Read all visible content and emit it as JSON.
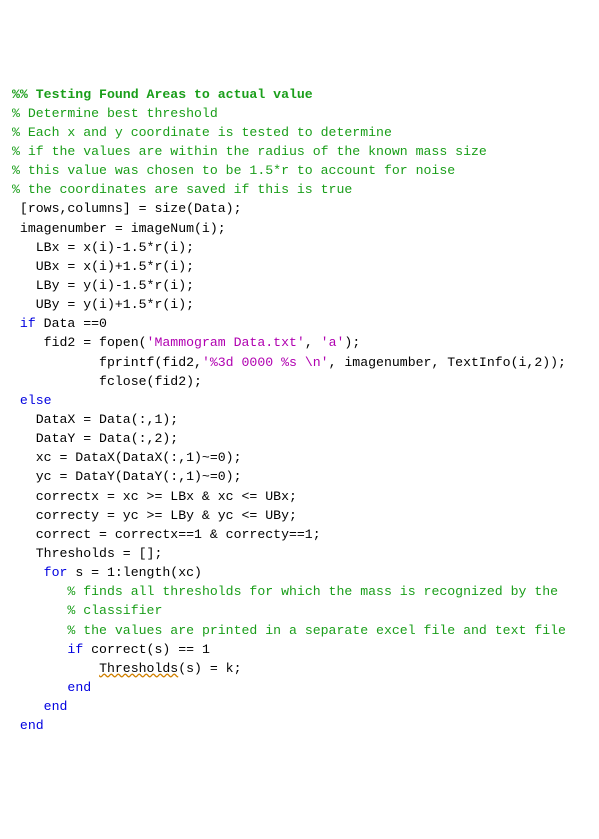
{
  "code": {
    "lines": [
      {
        "segments": [
          {
            "cls": "section",
            "text": "%% Testing Found Areas to actual value"
          }
        ]
      },
      {
        "segments": [
          {
            "cls": "comment",
            "text": "% Determine best threshold"
          }
        ]
      },
      {
        "segments": [
          {
            "cls": "comment",
            "text": "% Each x and y coordinate is tested to determine"
          }
        ]
      },
      {
        "segments": [
          {
            "cls": "comment",
            "text": "% if the values are within the radius of the known mass size"
          }
        ]
      },
      {
        "segments": [
          {
            "cls": "comment",
            "text": "% this value was chosen to be 1.5*r to account for noise"
          }
        ]
      },
      {
        "segments": [
          {
            "cls": "comment",
            "text": "% the coordinates are saved if this is true"
          }
        ]
      },
      {
        "segments": [
          {
            "cls": "code",
            "text": " [rows,columns] = size(Data);"
          }
        ]
      },
      {
        "segments": [
          {
            "cls": "code",
            "text": " imagenumber = imageNum(i);"
          }
        ]
      },
      {
        "segments": [
          {
            "cls": "code",
            "text": "   LBx = x(i)-1.5*r(i);"
          }
        ]
      },
      {
        "segments": [
          {
            "cls": "code",
            "text": "   UBx = x(i)+1.5*r(i);"
          }
        ]
      },
      {
        "segments": [
          {
            "cls": "code",
            "text": "   LBy = y(i)-1.5*r(i);"
          }
        ]
      },
      {
        "segments": [
          {
            "cls": "code",
            "text": "   UBy = y(i)+1.5*r(i);"
          }
        ]
      },
      {
        "segments": [
          {
            "cls": "code",
            "text": " "
          },
          {
            "cls": "keyword",
            "text": "if"
          },
          {
            "cls": "code",
            "text": " Data ==0"
          }
        ]
      },
      {
        "segments": [
          {
            "cls": "code",
            "text": "    fid2 = fopen("
          },
          {
            "cls": "string",
            "text": "'Mammogram Data.txt'"
          },
          {
            "cls": "code",
            "text": ", "
          },
          {
            "cls": "string",
            "text": "'a'"
          },
          {
            "cls": "code",
            "text": ");"
          }
        ]
      },
      {
        "segments": [
          {
            "cls": "code",
            "text": "           fprintf(fid2,"
          },
          {
            "cls": "string",
            "text": "'%3d 0000 %s \\n'"
          },
          {
            "cls": "code",
            "text": ", imagenumber, TextInfo(i,2));"
          }
        ]
      },
      {
        "segments": [
          {
            "cls": "code",
            "text": "           fclose(fid2);"
          }
        ]
      },
      {
        "segments": [
          {
            "cls": "code",
            "text": " "
          },
          {
            "cls": "keyword",
            "text": "else"
          }
        ]
      },
      {
        "segments": [
          {
            "cls": "code",
            "text": "   DataX = Data(:,1);"
          }
        ]
      },
      {
        "segments": [
          {
            "cls": "code",
            "text": "   DataY = Data(:,2);"
          }
        ]
      },
      {
        "segments": [
          {
            "cls": "code",
            "text": "   xc = DataX(DataX(:,1)~=0);"
          }
        ]
      },
      {
        "segments": [
          {
            "cls": "code",
            "text": "   yc = DataY(DataY(:,1)~=0);"
          }
        ]
      },
      {
        "segments": [
          {
            "cls": "code",
            "text": "   correctx = xc >= LBx & xc <= UBx;"
          }
        ]
      },
      {
        "segments": [
          {
            "cls": "code",
            "text": "   correcty = yc >= LBy & yc <= UBy;"
          }
        ]
      },
      {
        "segments": [
          {
            "cls": "code",
            "text": "   correct = correctx==1 & correcty==1;"
          }
        ]
      },
      {
        "segments": [
          {
            "cls": "code",
            "text": "   Thresholds = [];"
          }
        ]
      },
      {
        "segments": [
          {
            "cls": "code",
            "text": "    "
          },
          {
            "cls": "keyword",
            "text": "for"
          },
          {
            "cls": "code",
            "text": " s = 1:length(xc)"
          }
        ]
      },
      {
        "segments": [
          {
            "cls": "code",
            "text": "       "
          },
          {
            "cls": "comment",
            "text": "% finds all thresholds for which the mass is recognized by the"
          }
        ]
      },
      {
        "segments": [
          {
            "cls": "code",
            "text": "       "
          },
          {
            "cls": "comment",
            "text": "% classifier"
          }
        ]
      },
      {
        "segments": [
          {
            "cls": "code",
            "text": "       "
          },
          {
            "cls": "comment",
            "text": "% the values are printed in a separate excel file and text file"
          }
        ]
      },
      {
        "segments": [
          {
            "cls": "code",
            "text": "       "
          },
          {
            "cls": "keyword",
            "text": "if"
          },
          {
            "cls": "code",
            "text": " correct(s) == 1"
          }
        ]
      },
      {
        "segments": [
          {
            "cls": "code",
            "text": "           "
          },
          {
            "cls": "code underline",
            "text": "Thresholds"
          },
          {
            "cls": "code",
            "text": "(s) = k;"
          }
        ]
      },
      {
        "segments": [
          {
            "cls": "code",
            "text": "       "
          },
          {
            "cls": "keyword",
            "text": "end"
          }
        ]
      },
      {
        "segments": [
          {
            "cls": "code",
            "text": "    "
          },
          {
            "cls": "keyword",
            "text": "end"
          }
        ]
      },
      {
        "segments": [
          {
            "cls": "code",
            "text": " "
          },
          {
            "cls": "keyword",
            "text": "end"
          }
        ]
      }
    ]
  }
}
